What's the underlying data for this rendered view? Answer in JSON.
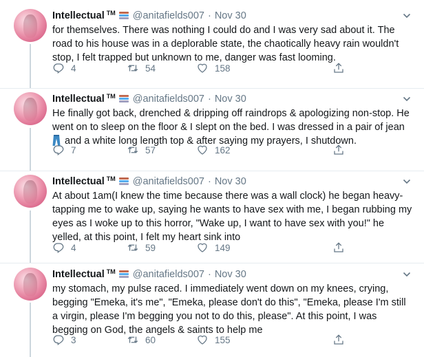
{
  "tweets": [
    {
      "name": "Intellectual",
      "tm": "TM",
      "handle": "@anitafields007",
      "dot": "·",
      "date": "Nov 30",
      "text": "for themselves. There was nothing I could do and I was very sad about it. The road to his house was in a deplorable state, the chaotically heavy rain wouldn't stop, I felt trapped but unknown to me, danger was fast looming.",
      "replies": "4",
      "retweets": "54",
      "likes": "158"
    },
    {
      "name": "Intellectual",
      "tm": "TM",
      "handle": "@anitafields007",
      "dot": "·",
      "date": "Nov 30",
      "text_before": "He finally got back, drenched & dripping off raindrops & apologizing non-stop. He went on to sleep on the floor & I slept on the bed. I was dressed in a pair of jean",
      "emoji": "jeans-emoji",
      "text_after": " and a white long length top & after saying my prayers, I shutdown.",
      "replies": "7",
      "retweets": "57",
      "likes": "162"
    },
    {
      "name": "Intellectual",
      "tm": "TM",
      "handle": "@anitafields007",
      "dot": "·",
      "date": "Nov 30",
      "text": "At about 1am(I knew the time because there was a wall clock) he began heavy-tapping me to wake up, saying he wants to have sex with me, I began rubbing my eyes as I woke up to this horror, \"Wake up, I want to have sex with you!\" he yelled, at this point, I felt my heart sink into",
      "replies": "4",
      "retweets": "59",
      "likes": "149"
    },
    {
      "name": "Intellectual",
      "tm": "TM",
      "handle": "@anitafields007",
      "dot": "·",
      "date": "Nov 30",
      "text": "my stomach, my pulse raced. I immediately went down on my knees, crying, begging \"Emeka, it's me\", \"Emeka, please don't do this\", \"Emeka, please I'm still a virgin, please I'm begging you not to do this, please\". At this point, I was begging on God, the angels & saints to help me",
      "replies": "3",
      "retweets": "60",
      "likes": "155"
    }
  ],
  "colors": {
    "text": "#14171a",
    "secondary": "#657786",
    "divider": "#e6ecf0",
    "thread_line": "#ccd6dd",
    "jeans": "#3b88c3"
  },
  "icons": [
    "reply-icon",
    "retweet-icon",
    "like-icon",
    "share-icon",
    "chevron-down-icon",
    "books-emoji-icon",
    "jeans-emoji-icon"
  ]
}
